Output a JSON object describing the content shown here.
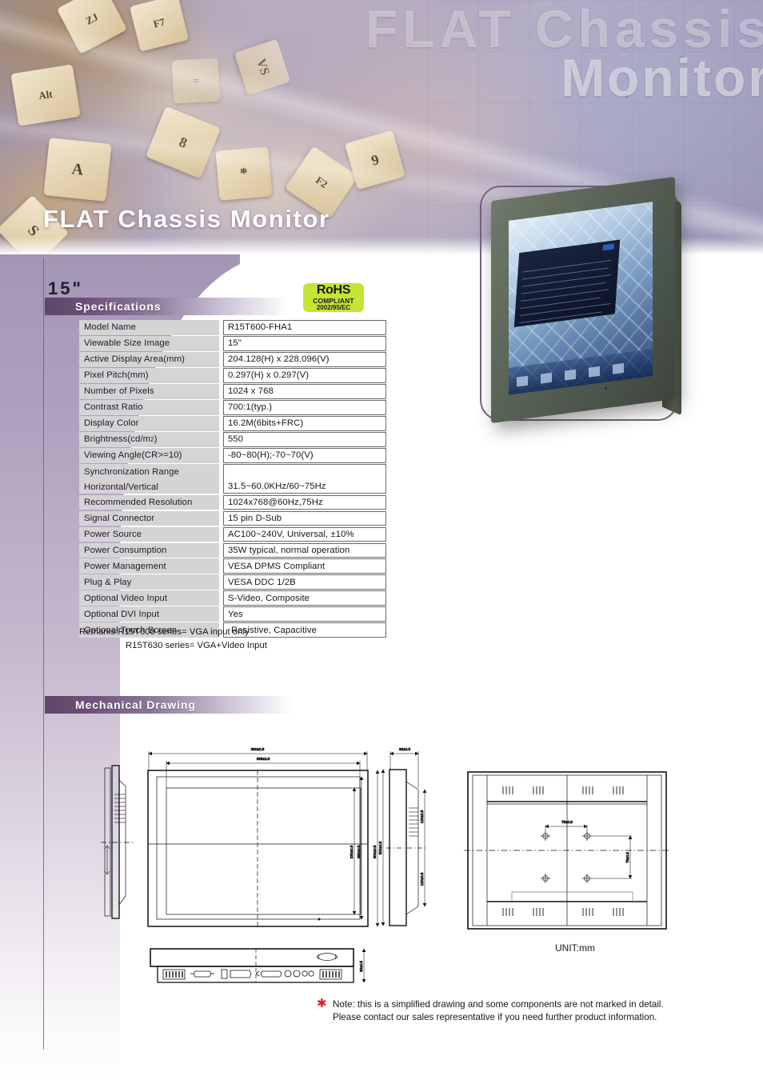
{
  "hero": {
    "ghost_line1": "FLAT Chassis",
    "ghost_line2": "Monitor",
    "banner_title": "FLAT Chassis Monitor"
  },
  "product": {
    "size_label": "15\"",
    "rohs": {
      "line1": "RoHS",
      "line2": "COMPLIANT",
      "line3": "2002/95/EC"
    }
  },
  "sections": {
    "specifications": "Specifications",
    "mechanical_drawing": "Mechanical Drawing"
  },
  "spec_table": {
    "rows": [
      {
        "key": "Model Name",
        "value": "R15T600-FHA1"
      },
      {
        "key": "Viewable Size Image",
        "value": "15\""
      },
      {
        "key": "Active Display Area(mm)",
        "value": "204.128(H) x 228.096(V)"
      },
      {
        "key": "Pixel Pitch(mm)",
        "value": "0.297(H) x 0.297(V)"
      },
      {
        "key": "Number of Pixels",
        "value": "1024 x 768"
      },
      {
        "key": "Contrast Ratio",
        "value": "700:1(typ.)"
      },
      {
        "key": "Display Color",
        "value": "16.2M(6bits+FRC)"
      },
      {
        "key": "Brightness(cd/m2)",
        "value": "550"
      },
      {
        "key": "Viewing Angle(CR>=10)",
        "value": "-80~80(H);-70~70(V)"
      },
      {
        "key": "Synchronization Range",
        "key2": "Horizontal/Vertical",
        "value": "31.5~60.0KHz/60~75Hz"
      },
      {
        "key": "Recommended Resolution",
        "value": "1024x768@60Hz,75Hz"
      },
      {
        "key": "Signal Connector",
        "value": "15 pin D-Sub"
      },
      {
        "key": "Power Source",
        "value": "AC100~240V, Universal, ±10%"
      },
      {
        "key": "Power Consumption",
        "value": "35W typical, normal operation"
      },
      {
        "key": "Power Management",
        "value": "VESA DPMS Compliant"
      },
      {
        "key": "Plug & Play",
        "value": "VESA DDC 1/2B"
      },
      {
        "key": "Optional Video Input",
        "value": "S-Video, Composite"
      },
      {
        "key": "Optional DVI Input",
        "value": "Yes"
      },
      {
        "key": "Optional Touch Screen",
        "value": "Resistive, Capacitive"
      }
    ],
    "remarks_line1": "Remarks:R15T600 series= VGA input only",
    "remarks_line2": "R15T630 series= VGA+Video Input"
  },
  "mechanical": {
    "unit_label": "UNIT:mm",
    "dims": {
      "front_outer_width": "360±0.5",
      "front_inner_width": "336±0.5",
      "front_inner_height": "230±0.5",
      "front_mid_height": "280±0.5",
      "front_outer_height": "300±0.5",
      "side_depth": "62±0.5",
      "side_height": "300±0.5",
      "side_upper": "120±0.5",
      "side_lower": "120±0.5",
      "vesa_horizontal": "75±0.5",
      "vesa_vertical": "75±0.5",
      "bottom_height": "62±0.5"
    },
    "note_line1": "Note: this is a simplified drawing and some components are not marked in detail.",
    "note_line2": "Please contact our sales representative if you need further product information.",
    "note_star": "✱"
  },
  "colors": {
    "accent_purple": "#5d4668",
    "band_purple": "#a396b4",
    "rohs_green": "#c4e533",
    "note_star_red": "#e02020",
    "monitor_body": "#596356"
  }
}
